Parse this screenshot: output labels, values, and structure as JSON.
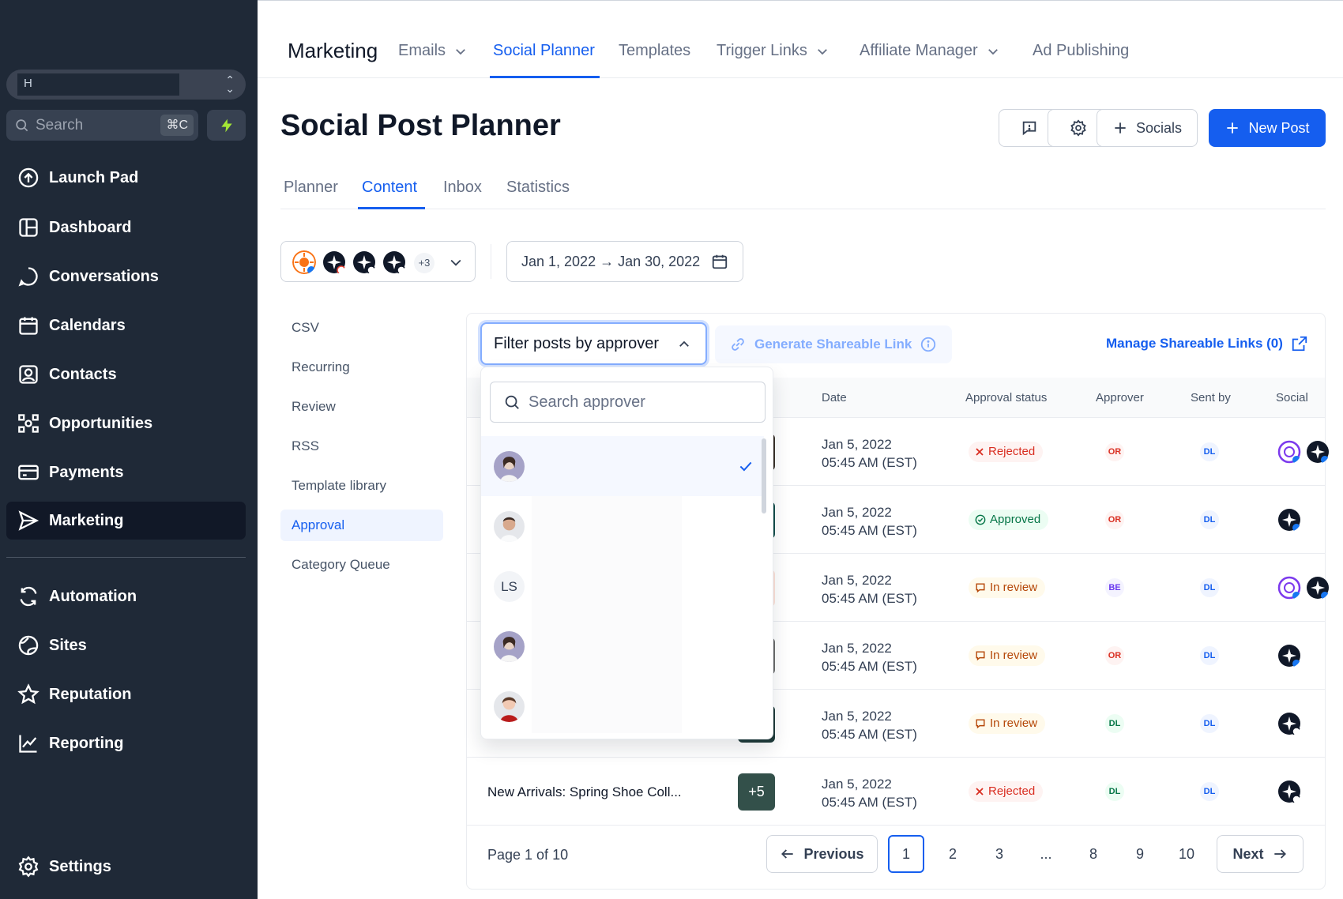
{
  "sidebar": {
    "location_name": "H",
    "search_placeholder": "Search",
    "search_shortcut": "⌘C",
    "nav": [
      {
        "label": "Launch Pad",
        "icon": "launch-pad-icon"
      },
      {
        "label": "Dashboard",
        "icon": "dashboard-icon"
      },
      {
        "label": "Conversations",
        "icon": "chat-icon"
      },
      {
        "label": "Calendars",
        "icon": "calendar-icon"
      },
      {
        "label": "Contacts",
        "icon": "contact-icon"
      },
      {
        "label": "Opportunities",
        "icon": "opportunities-icon"
      },
      {
        "label": "Payments",
        "icon": "credit-card-icon"
      },
      {
        "label": "Marketing",
        "icon": "send-icon",
        "active": true
      },
      {
        "label": "Automation",
        "icon": "refresh-icon"
      },
      {
        "label": "Sites",
        "icon": "globe-icon"
      },
      {
        "label": "Reputation",
        "icon": "star-icon"
      },
      {
        "label": "Reporting",
        "icon": "chart-line-icon"
      },
      {
        "label": "Settings",
        "icon": "gear-icon"
      }
    ]
  },
  "topbar": {
    "brand": "Marketing",
    "tabs": [
      {
        "label": "Emails",
        "dropdown": true
      },
      {
        "label": "Social Planner",
        "active": true
      },
      {
        "label": "Templates"
      },
      {
        "label": "Trigger Links",
        "dropdown": true
      },
      {
        "label": "Affiliate Manager",
        "dropdown": true
      },
      {
        "label": "Ad Publishing"
      }
    ]
  },
  "page": {
    "title": "Social Post Planner",
    "socials_label": "Socials",
    "new_post_label": "New Post",
    "subtabs": [
      "Planner",
      "Content",
      "Inbox",
      "Statistics"
    ],
    "active_subtab": "Content"
  },
  "filters": {
    "accounts_more": "+3",
    "date_range": "Jan 1, 2022 → Jan 30, 2022"
  },
  "content_menu": [
    "CSV",
    "Recurring",
    "Review",
    "RSS",
    "Template library",
    "Approval",
    "Category Queue"
  ],
  "content_menu_active": "Approval",
  "toolbar": {
    "filter_label": "Filter posts by approver",
    "generate_link": "Generate Shareable Link",
    "manage_links": "Manage Shareable Links (0)"
  },
  "dropdown": {
    "search_placeholder": "Search approver",
    "items": [
      {
        "type": "photo",
        "selected": true
      },
      {
        "type": "photo"
      },
      {
        "type": "initials",
        "initials": "LS"
      },
      {
        "type": "photo"
      },
      {
        "type": "photo"
      }
    ]
  },
  "table": {
    "columns": [
      "Date",
      "Approval status",
      "Approver",
      "Sent by",
      "Social"
    ],
    "rows": [
      {
        "title": "",
        "date": "Jan 5, 2022",
        "time": "05:45 AM (EST)",
        "status": "Rejected",
        "approver": "OR",
        "sent_by": "DL",
        "socials": [
          "instagram-purple",
          "star-facebook"
        ]
      },
      {
        "title": "",
        "date": "Jan 5, 2022",
        "time": "05:45 AM (EST)",
        "status": "Approved",
        "approver": "OR",
        "sent_by": "DL",
        "socials": [
          "star-facebook"
        ]
      },
      {
        "title": "",
        "date": "Jan 5, 2022",
        "time": "05:45 AM (EST)",
        "status": "In review",
        "approver": "BE",
        "sent_by": "DL",
        "socials": [
          "instagram-purple",
          "star-facebook"
        ]
      },
      {
        "title": "",
        "date": "Jan 5, 2022",
        "time": "05:45 AM (EST)",
        "status": "In review",
        "approver": "OR",
        "sent_by": "DL",
        "socials": [
          "star-facebook"
        ]
      },
      {
        "title": "",
        "date": "Jan 5, 2022",
        "time": "05:45 AM (EST)",
        "status": "In review",
        "approver": "DL",
        "sent_by": "DL",
        "socials": [
          "star-instagram"
        ]
      },
      {
        "title": "New Arrivals: Spring Shoe Coll...",
        "thumb_label": "+5",
        "date": "Jan 5, 2022",
        "time": "05:45 AM (EST)",
        "status": "Rejected",
        "approver": "DL",
        "sent_by": "DL",
        "socials": [
          "star-instagram"
        ]
      }
    ]
  },
  "pagination": {
    "label": "Page 1 of 10",
    "previous": "Previous",
    "next": "Next",
    "pages": [
      "1",
      "2",
      "3",
      "...",
      "8",
      "9",
      "10"
    ],
    "current": "1"
  },
  "colors": {
    "sidebar_bg": "#1f2937",
    "accent": "#155eef",
    "rejected": "#d92d20",
    "approved": "#067647",
    "in_review": "#b54708"
  }
}
